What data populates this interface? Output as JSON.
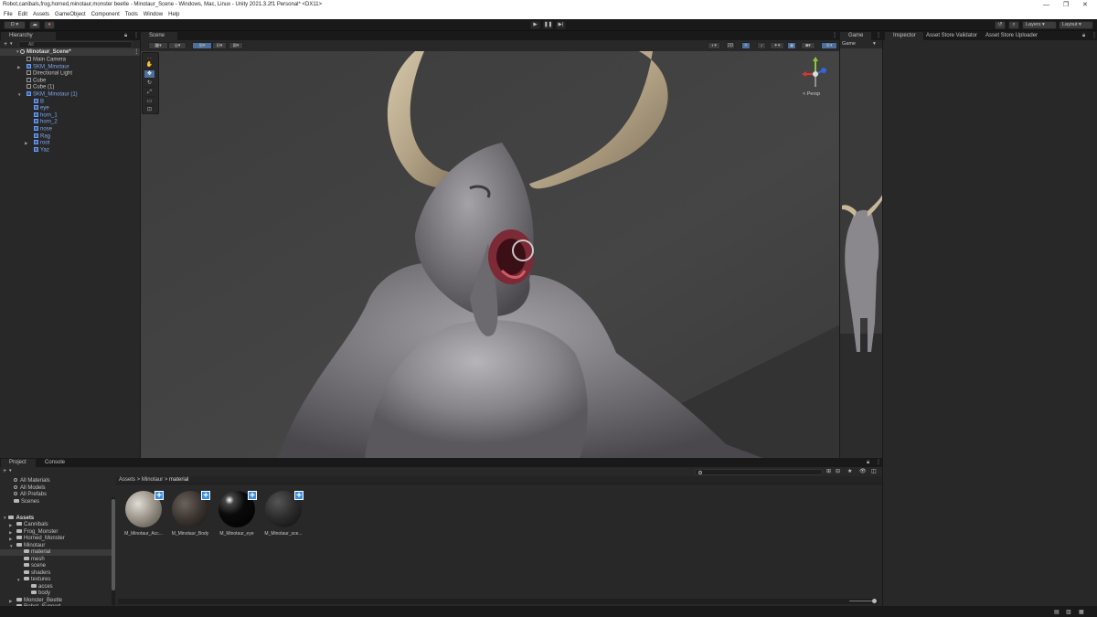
{
  "window": {
    "title": "Robot,canibals,frog,horned,minotaur,monster beetle - Minotaur_Scene - Windows, Mac, Linux - Unity 2021.3.2f1 Personal* <DX11>",
    "min_icon": "minimize-icon",
    "max_icon": "maximize-icon",
    "close_icon": "close-icon"
  },
  "menu": [
    "File",
    "Edit",
    "Assets",
    "GameObject",
    "Component",
    "Tools",
    "Window",
    "Help"
  ],
  "toolbar": {
    "account": "D",
    "layers": "Layers",
    "layout": "Layout"
  },
  "hierarchy": {
    "tab": "Hierarchy",
    "add": "+",
    "search_placeholder": "All",
    "scene": "Minotaur_Scene*",
    "items": [
      {
        "label": "Main Camera",
        "depth": 1,
        "prefab": false,
        "expand": ""
      },
      {
        "label": "SKM_Minotaur",
        "depth": 1,
        "prefab": true,
        "expand": "▶"
      },
      {
        "label": "Directional Light",
        "depth": 1,
        "prefab": false,
        "expand": ""
      },
      {
        "label": "Cube",
        "depth": 1,
        "prefab": false,
        "expand": ""
      },
      {
        "label": "Cube (1)",
        "depth": 1,
        "prefab": false,
        "expand": ""
      },
      {
        "label": "SKM_Minotaur (1)",
        "depth": 1,
        "prefab": true,
        "expand": "▼"
      },
      {
        "label": "B",
        "depth": 2,
        "prefab": true,
        "expand": ""
      },
      {
        "label": "eye",
        "depth": 2,
        "prefab": true,
        "expand": ""
      },
      {
        "label": "horn_1",
        "depth": 2,
        "prefab": true,
        "expand": ""
      },
      {
        "label": "horn_2",
        "depth": 2,
        "prefab": true,
        "expand": ""
      },
      {
        "label": "nose",
        "depth": 2,
        "prefab": true,
        "expand": ""
      },
      {
        "label": "Rag",
        "depth": 2,
        "prefab": true,
        "expand": ""
      },
      {
        "label": "root",
        "depth": 2,
        "prefab": true,
        "expand": "▶"
      },
      {
        "label": "Yaz",
        "depth": 2,
        "prefab": true,
        "expand": ""
      }
    ]
  },
  "scene": {
    "tab": "Scene",
    "persp": "< Persp"
  },
  "game": {
    "tab": "Game",
    "display": "Game"
  },
  "inspector": {
    "tabs": [
      "Inspector",
      "Asset Store Validator",
      "Asset Store Uploader"
    ]
  },
  "project": {
    "tabs": [
      "Project",
      "Console"
    ],
    "add": "+",
    "favorites": [
      "All Materials",
      "All Models",
      "All Prefabs",
      "Scenes"
    ],
    "assets_root": "Assets",
    "tree": [
      {
        "label": "Cannibals",
        "depth": 1,
        "expand": "▶"
      },
      {
        "label": "Frog_Monster",
        "depth": 1,
        "expand": "▶"
      },
      {
        "label": "Horned_Monster",
        "depth": 1,
        "expand": "▶"
      },
      {
        "label": "Minotaur",
        "depth": 1,
        "expand": "▼"
      },
      {
        "label": "material",
        "depth": 2,
        "expand": ""
      },
      {
        "label": "mesh",
        "depth": 2,
        "expand": ""
      },
      {
        "label": "scene",
        "depth": 2,
        "expand": ""
      },
      {
        "label": "shaders",
        "depth": 2,
        "expand": ""
      },
      {
        "label": "textures",
        "depth": 2,
        "expand": "▼"
      },
      {
        "label": "acces",
        "depth": 3,
        "expand": ""
      },
      {
        "label": "body",
        "depth": 3,
        "expand": ""
      },
      {
        "label": "Monster_Beetle",
        "depth": 1,
        "expand": "▶"
      },
      {
        "label": "Robot_Support",
        "depth": 1,
        "expand": "▶"
      }
    ],
    "breadcrumb": [
      "Assets",
      "Minotaur",
      "material"
    ],
    "assets": [
      {
        "label": "M_Minotaur_Acc...",
        "style": "stone"
      },
      {
        "label": "M_Minotaur_Body",
        "style": "dark"
      },
      {
        "label": "M_Minotaur_eye",
        "style": "black"
      },
      {
        "label": "M_Minotaur_sce...",
        "style": "grey"
      }
    ]
  }
}
